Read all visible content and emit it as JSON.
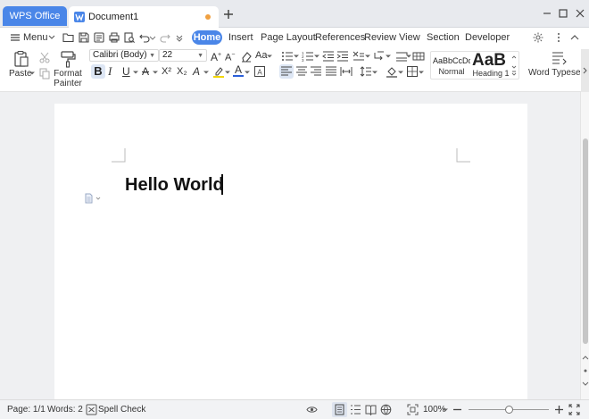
{
  "titlebar": {
    "app_tab": "WPS Office",
    "doc_tab": "Document1",
    "unsaved_dot_color": "#f0a040",
    "accent": "#4a86e8"
  },
  "menubar": {
    "menu_label": "Menu",
    "tabs": [
      "Home",
      "Insert",
      "Page Layout",
      "References",
      "Review",
      "View",
      "Section",
      "Developer"
    ],
    "active_tab": "Home"
  },
  "ribbon": {
    "paste_label": "Paste",
    "format_painter_label_1": "Format",
    "format_painter_label_2": "Painter",
    "font_name": "Calibri (Body)",
    "font_size": "22",
    "bold": "B",
    "italic": "I",
    "underline": "U",
    "strikethrough": "A",
    "superscript": "X²",
    "subscript": "X₂",
    "text_effect": "A",
    "font_color": "A",
    "change_case": "Aa",
    "style_normal_preview": "AaBbCcDd",
    "style_normal": "Normal",
    "style_heading_preview": "AaB",
    "style_heading": "Heading 1",
    "word_typesetting": "Word Typesetting"
  },
  "document": {
    "text": "Hello World"
  },
  "statusbar": {
    "page": "Page: 1/1",
    "words": "Words: 2",
    "spell_check": "Spell Check",
    "zoom": "100%",
    "zoom_level": 0.5
  }
}
